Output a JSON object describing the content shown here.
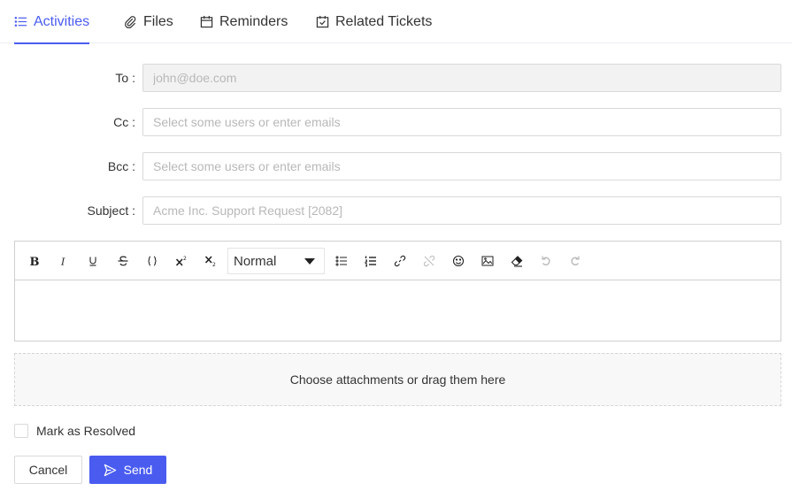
{
  "tabs": [
    {
      "label": "Activities",
      "icon": "list-icon",
      "active": true
    },
    {
      "label": "Files",
      "icon": "paperclip-icon",
      "active": false
    },
    {
      "label": "Reminders",
      "icon": "calendar-icon",
      "active": false
    },
    {
      "label": "Related Tickets",
      "icon": "calendar-check-icon",
      "active": false
    }
  ],
  "form": {
    "to": {
      "label": "To",
      "value": "john@doe.com"
    },
    "cc": {
      "label": "Cc",
      "placeholder": "Select some users or enter emails"
    },
    "bcc": {
      "label": "Bcc",
      "placeholder": "Select some users or enter emails"
    },
    "subject": {
      "label": "Subject",
      "placeholder": "Acme Inc. Support Request [2082]"
    }
  },
  "editor": {
    "toolbar": [
      "bold",
      "italic",
      "underline",
      "strike",
      "code",
      "superscript",
      "subscript",
      "header-select",
      "bullet-list",
      "ordered-list",
      "link",
      "unlink",
      "emoji",
      "image",
      "clean",
      "undo",
      "redo"
    ],
    "format_value": "Normal",
    "content": ""
  },
  "attachments": {
    "label": "Choose attachments or drag them here"
  },
  "resolve": {
    "label": "Mark as Resolved",
    "checked": false
  },
  "buttons": {
    "cancel": "Cancel",
    "send": "Send"
  },
  "colors": {
    "accent": "#4a5cf0"
  }
}
